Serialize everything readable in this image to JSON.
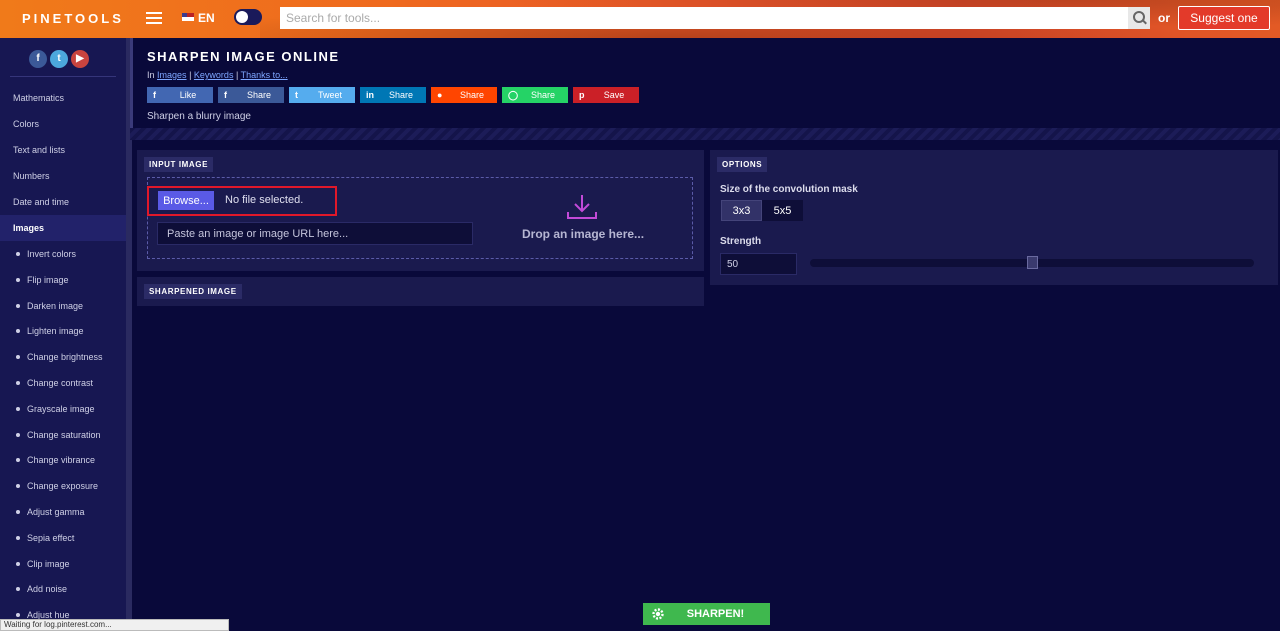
{
  "topbar": {
    "logo": "PINETOOLS",
    "language": "EN",
    "search_placeholder": "Search for tools...",
    "or_label": "or",
    "suggest_label": "Suggest one"
  },
  "sidebar": {
    "social": [
      "f",
      "t",
      "▶"
    ],
    "items": [
      {
        "label": "Mathematics"
      },
      {
        "label": "Colors"
      },
      {
        "label": "Text and lists"
      },
      {
        "label": "Numbers"
      },
      {
        "label": "Date and time"
      },
      {
        "label": "Images"
      }
    ],
    "sub_items": [
      {
        "label": "Invert colors"
      },
      {
        "label": "Flip image"
      },
      {
        "label": "Darken image"
      },
      {
        "label": "Lighten image"
      },
      {
        "label": "Change brightness"
      },
      {
        "label": "Change contrast"
      },
      {
        "label": "Grayscale image"
      },
      {
        "label": "Change saturation"
      },
      {
        "label": "Change vibrance"
      },
      {
        "label": "Change exposure"
      },
      {
        "label": "Adjust gamma"
      },
      {
        "label": "Sepia effect"
      },
      {
        "label": "Clip image"
      },
      {
        "label": "Add noise"
      },
      {
        "label": "Adjust hue"
      }
    ]
  },
  "header": {
    "title": "SHARPEN IMAGE ONLINE",
    "breadcrumb_in": "In",
    "breadcrumb_images": "Images",
    "breadcrumb_sep": "|",
    "breadcrumb_keywords": "Keywords",
    "breadcrumb_thanks": "Thanks to...",
    "tagline": "Sharpen a blurry image"
  },
  "share": [
    {
      "label": "Like",
      "icon": "facebook-icon",
      "glyph": "f",
      "color": "#4267b2"
    },
    {
      "label": "Share",
      "icon": "facebook-icon",
      "glyph": "f",
      "color": "#3b5998"
    },
    {
      "label": "Tweet",
      "icon": "twitter-icon",
      "glyph": "t",
      "color": "#55acee"
    },
    {
      "label": "Share",
      "icon": "linkedin-icon",
      "glyph": "in",
      "color": "#0077b5"
    },
    {
      "label": "Share",
      "icon": "reddit-icon",
      "glyph": "●",
      "color": "#ff4500"
    },
    {
      "label": "Share",
      "icon": "whatsapp-icon",
      "glyph": "◯",
      "color": "#25d366"
    },
    {
      "label": "Save",
      "icon": "pinterest-icon",
      "glyph": "p",
      "color": "#cb2027"
    }
  ],
  "input_panel": {
    "tag": "INPUT IMAGE",
    "browse_label": "Browse...",
    "file_status": "No file selected.",
    "paste_placeholder": "Paste an image or image URL here...",
    "drop_text": "Drop an image here..."
  },
  "output_panel": {
    "tag": "SHARPENED IMAGE"
  },
  "options": {
    "tag": "OPTIONS",
    "mask_label": "Size of the convolution mask",
    "mask_options": [
      "3x3",
      "5x5"
    ],
    "mask_selected": "3x3",
    "strength_label": "Strength",
    "strength_value": "50"
  },
  "action": {
    "sharpen_label": "SHARPEN!"
  },
  "status_bar": "Waiting for log.pinterest.com..."
}
